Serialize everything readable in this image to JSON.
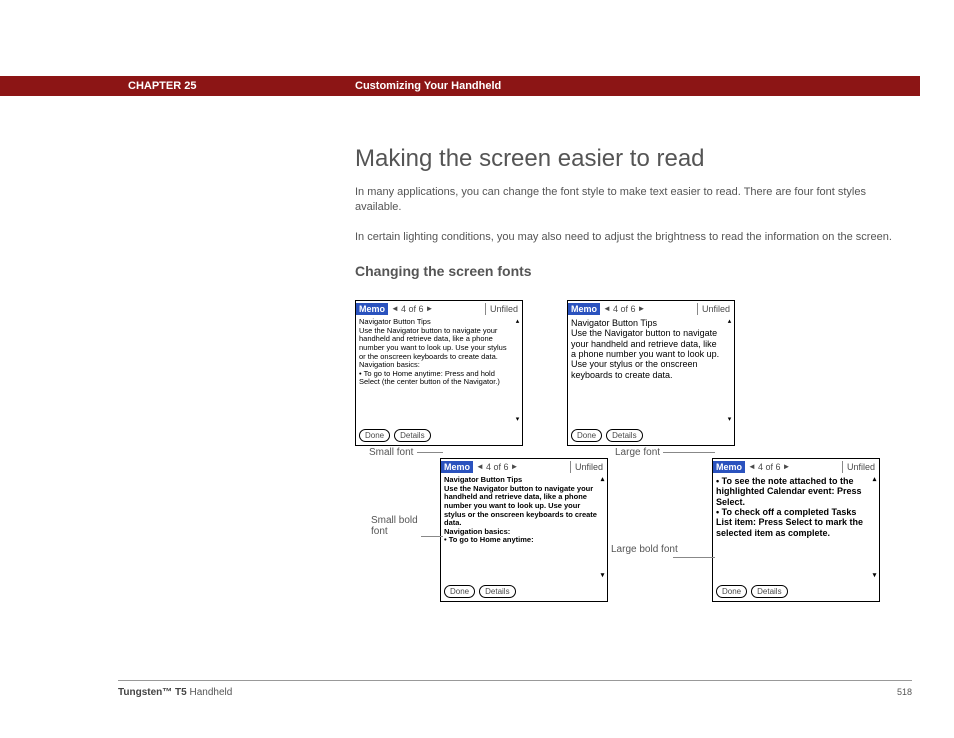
{
  "header": {
    "chapter": "CHAPTER 25",
    "title": "Customizing Your Handheld"
  },
  "main": {
    "h1": "Making the screen easier to read",
    "p1": "In many applications, you can change the font style to make text easier to read. There are four font styles available.",
    "p2": "In certain lighting conditions, you may also need to adjust the brightness to read the information on the screen.",
    "h2": "Changing the screen fonts"
  },
  "memo_common": {
    "app": "Memo",
    "counter": "4 of 6",
    "category": "Unfiled",
    "done": "Done",
    "details": "Details",
    "arrow_left": "◄",
    "arrow_right": "►",
    "scroll_up": "▴",
    "scroll_down": "▾"
  },
  "memos": {
    "small": {
      "lines": [
        "Navigator Button Tips",
        "Use the Navigator button to navigate your handheld and retrieve data, like a phone number you want to look up. Use your stylus or the onscreen keyboards to create data.",
        "",
        "Navigation basics:",
        "• To go to Home anytime: Press and hold Select (the center button of the Navigator.)"
      ]
    },
    "large": {
      "lines": [
        "Navigator Button Tips",
        "Use the Navigator button to navigate your handheld and retrieve data, like a phone number you want to look up. Use your stylus or the onscreen keyboards to create data."
      ]
    },
    "small_bold": {
      "lines": [
        "Navigator Button Tips",
        "Use the Navigator button to navigate your handheld and retrieve data, like a phone number you want to look up. Use your stylus or the onscreen keyboards to create data.",
        "",
        "Navigation basics:",
        "• To go to Home anytime:"
      ]
    },
    "large_bold": {
      "lines": [
        "• To see the note attached to the highlighted Calendar event: Press Select.",
        "• To check off a completed Tasks List item: Press Select to mark the selected item as complete."
      ]
    }
  },
  "captions": {
    "small": "Small font",
    "large": "Large font",
    "small_bold": "Small bold font",
    "large_bold": "Large bold font"
  },
  "footer": {
    "product_bold": "Tungsten™ T5",
    "product_rest": " Handheld",
    "page": "518"
  }
}
